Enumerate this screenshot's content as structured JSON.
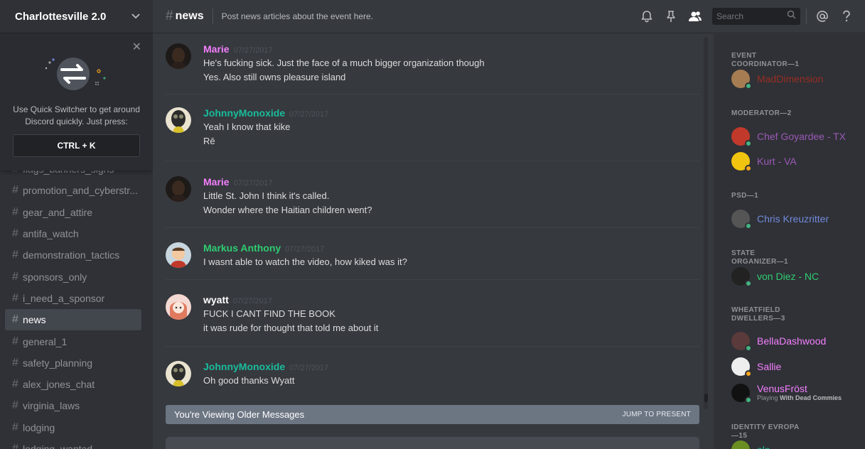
{
  "guild": {
    "name": "Charlottesville 2.0"
  },
  "switcher": {
    "line1": "Use Quick Switcher to get around",
    "line2": "Discord quickly. Just press:",
    "key": "CTRL + K"
  },
  "channels": [
    {
      "name": "flags_banners_signs",
      "active": false
    },
    {
      "name": "promotion_and_cyberstr...",
      "active": false
    },
    {
      "name": "gear_and_attire",
      "active": false
    },
    {
      "name": "antifa_watch",
      "active": false
    },
    {
      "name": "demonstration_tactics",
      "active": false
    },
    {
      "name": "sponsors_only",
      "active": false
    },
    {
      "name": "i_need_a_sponsor",
      "active": false
    },
    {
      "name": "news",
      "active": true
    },
    {
      "name": "general_1",
      "active": false
    },
    {
      "name": "safety_planning",
      "active": false
    },
    {
      "name": "alex_jones_chat",
      "active": false
    },
    {
      "name": "virginia_laws",
      "active": false
    },
    {
      "name": "lodging",
      "active": false
    },
    {
      "name": "lodging_wanted",
      "active": false
    }
  ],
  "topbar": {
    "channel_name": "news",
    "topic": "Post news articles about the event here.",
    "search_placeholder": "Search"
  },
  "messages": [
    {
      "author": "Marie",
      "color": "#f47fff",
      "ts": "07/27/2017",
      "avatar": "dark",
      "lines": [
        "He's fucking sick. Just the face of a much bigger organization though",
        "Yes. Also still owns pleasure island"
      ]
    },
    {
      "author": "JohnnyMonoxide",
      "color": "#1abc9c",
      "ts": "07/27/2017",
      "avatar": "gasmask",
      "lines": [
        "Yeah I know that kike",
        "Rē"
      ]
    },
    {
      "author": "Marie",
      "color": "#f47fff",
      "ts": "07/27/2017",
      "avatar": "dark",
      "lines": [
        "Little St. John I think it's called.",
        "Wonder where the Haitian children went?"
      ]
    },
    {
      "author": "Markus Anthony",
      "color": "#2ecc71",
      "ts": "07/27/2017",
      "avatar": "cartoon",
      "lines": [
        "I wasnt able to watch the video, how kiked was it?"
      ]
    },
    {
      "author": "wyatt",
      "color": "#ffffff",
      "ts": "07/27/2017",
      "avatar": "anime",
      "lines": [
        "FUCK I CANT FIND THE BOOK",
        "it was rude for thought that told me about it"
      ]
    },
    {
      "author": "JohnnyMonoxide",
      "color": "#1abc9c",
      "ts": "07/27/2017",
      "avatar": "gasmask",
      "lines": [
        "Oh good thanks Wyatt"
      ]
    }
  ],
  "older_bar": {
    "text": "You're Viewing Older Messages",
    "jump": "JUMP TO PRESENT"
  },
  "roles": [
    {
      "title": "EVENT COORDINATOR—1",
      "members": [
        {
          "name": "MadDimension",
          "color": "#992d22",
          "status": "online",
          "av": "#a67c52"
        }
      ]
    },
    {
      "title": "MODERATOR—2",
      "members": [
        {
          "name": "Chef Goyardee - TX",
          "color": "#9b59b6",
          "status": "online",
          "av": "#c0392b"
        },
        {
          "name": "Kurt - VA",
          "color": "#9b59b6",
          "status": "idle",
          "av": "#f1c40f"
        }
      ]
    },
    {
      "title": "PSD—1",
      "members": [
        {
          "name": "Chris Kreuzritter",
          "color": "#7289da",
          "status": "online",
          "av": "#555"
        }
      ]
    },
    {
      "title": "STATE ORGANIZER—1",
      "members": [
        {
          "name": "von Diez - NC",
          "color": "#2ecc71",
          "status": "online",
          "av": "#222"
        }
      ]
    },
    {
      "title": "WHEATFIELD DWELLERS—3",
      "members": [
        {
          "name": "BellaDashwood",
          "color": "#f47fff",
          "status": "online",
          "av": "#5a3a3a"
        },
        {
          "name": "Sallie",
          "color": "#f47fff",
          "status": "idle",
          "av": "#eee"
        },
        {
          "name": "VenusFröst",
          "color": "#f47fff",
          "status": "online",
          "av": "#111",
          "game_prefix": "Playing ",
          "game": "With Dead Commies"
        }
      ]
    },
    {
      "title": "IDENTITY EVROPA—15",
      "members": [
        {
          "name": "ala",
          "color": "#1abc9c",
          "status": "online",
          "av": "#6b8e23"
        }
      ]
    }
  ],
  "colors": {
    "bg": "#36393e",
    "sidebar": "#2f3136",
    "online": "#43b581",
    "idle": "#faa61a"
  }
}
